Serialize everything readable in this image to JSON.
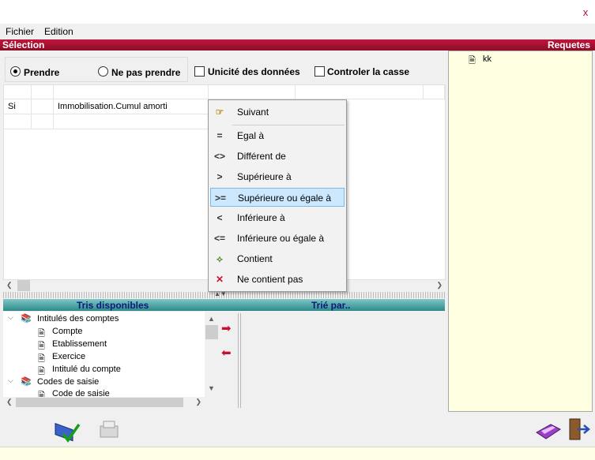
{
  "window": {
    "close_glyph": "x"
  },
  "menu": {
    "file": "Fichier",
    "edit": "Edition"
  },
  "selection_bar": {
    "title": "Sélection",
    "right_title": "Requetes"
  },
  "options": {
    "take": "Prendre",
    "not_take": "Ne pas prendre",
    "unique": "Unicité des données",
    "case": "Controler la casse",
    "selected_radio": "Prendre"
  },
  "grid": {
    "rows": [
      {
        "cond": "Si",
        "field": "Immobilisation.Cumul amorti"
      }
    ]
  },
  "sorts": {
    "available_label": "Tris disponibles",
    "sorted_by_label": "Trié par.."
  },
  "tree": {
    "groups": [
      {
        "label": "Intitulés des comptes",
        "children": [
          "Compte",
          "Etablissement",
          "Exercice",
          "Intitulé du compte"
        ]
      },
      {
        "label": "Codes de saisie",
        "children": [
          "Code de saisie"
        ]
      }
    ]
  },
  "requests": {
    "items": [
      "kk"
    ]
  },
  "context_menu": {
    "items": [
      {
        "icon": "pointing-hand-icon",
        "label": "Suivant"
      },
      {
        "icon": "equal-icon",
        "glyph": "=",
        "label": "Egal à"
      },
      {
        "icon": "not-equal-icon",
        "glyph": "<>",
        "label": "Différent de"
      },
      {
        "icon": "greater-icon",
        "glyph": ">",
        "label": "Supérieure à"
      },
      {
        "icon": "greater-equal-icon",
        "glyph": ">=",
        "label": "Supérieure ou égale à"
      },
      {
        "icon": "less-icon",
        "glyph": "<",
        "label": "Inférieure à"
      },
      {
        "icon": "less-equal-icon",
        "glyph": "<=",
        "label": "Inférieure ou égale à"
      },
      {
        "icon": "contains-icon",
        "glyph": "⟡",
        "label": "Contient"
      },
      {
        "icon": "not-contains-icon",
        "glyph": "✕",
        "label": "Ne contient pas"
      }
    ],
    "highlighted": "Supérieure ou égale à"
  },
  "colors": {
    "accent_red": "#b0102a",
    "highlight": "#cce8ff",
    "teal": "#2d8a8a",
    "pane_yellow": "#ffffe1"
  }
}
